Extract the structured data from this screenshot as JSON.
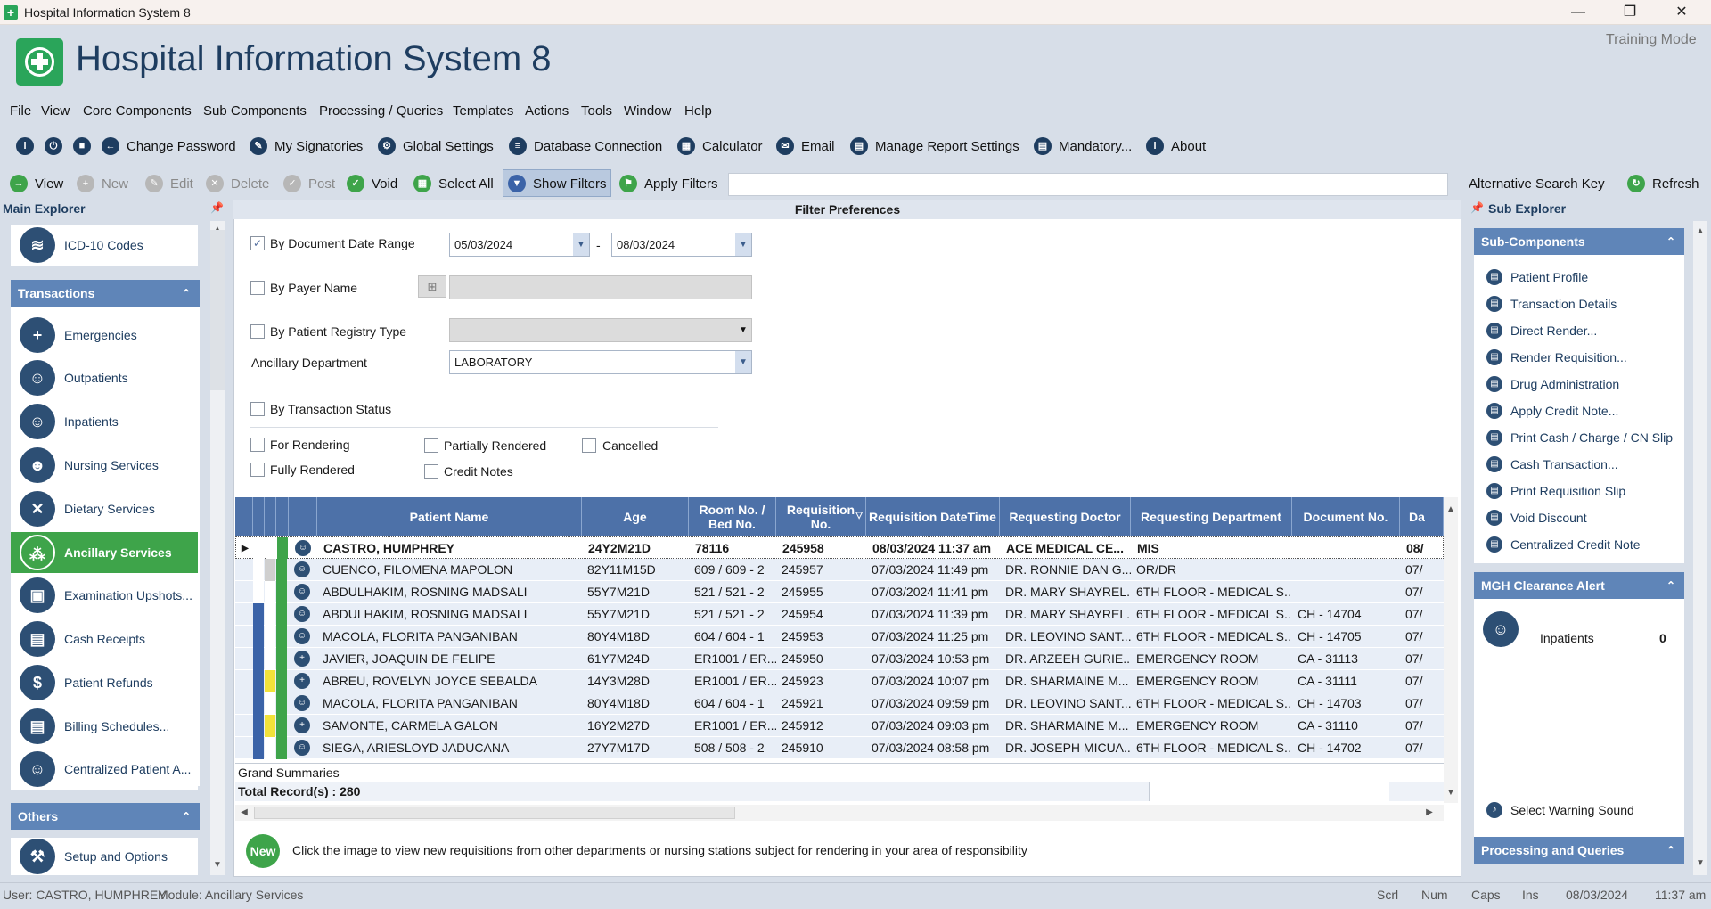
{
  "window": {
    "title": "Hospital Information System 8",
    "minimize": "—",
    "restore": "❐",
    "close": "✕"
  },
  "header": {
    "app_title": "Hospital Information System 8",
    "training_mode": "Training Mode"
  },
  "menu": [
    "File",
    "View",
    "Core Components",
    "Sub Components",
    "Processing / Queries",
    "Templates",
    "Actions",
    "Tools",
    "Window",
    "Help"
  ],
  "toolbar1": {
    "change_password": "Change Password",
    "my_signatories": "My Signatories",
    "global_settings": "Global Settings",
    "database_connection": "Database Connection",
    "calculator": "Calculator",
    "email": "Email",
    "manage_report_settings": "Manage Report Settings",
    "mandatory": "Mandatory...",
    "about": "About"
  },
  "toolbar2": {
    "view": "View",
    "new": "New",
    "edit": "Edit",
    "delete": "Delete",
    "post": "Post",
    "void": "Void",
    "select_all": "Select All",
    "show_filters": "Show Filters",
    "apply_filters": "Apply Filters",
    "alt_search_key": "Alternative Search Key",
    "refresh": "Refresh"
  },
  "main_explorer": {
    "title": "Main Explorer",
    "icd10": "ICD-10 Codes",
    "transactions_header": "Transactions",
    "transactions": [
      "Emergencies",
      "Outpatients",
      "Inpatients",
      "Nursing Services",
      "Dietary Services",
      "Ancillary Services",
      "Examination Upshots...",
      "Cash Receipts",
      "Patient Refunds",
      "Billing Schedules...",
      "Centralized Patient A..."
    ],
    "others_header": "Others",
    "setup": "Setup and Options"
  },
  "filter": {
    "title": "Filter Preferences",
    "by_doc_date": "By Document Date Range",
    "date_from": "05/03/2024",
    "date_sep": "-",
    "date_to": "08/03/2024",
    "by_payer": "By Payer Name",
    "by_registry": "By Patient Registry Type",
    "ancillary_label": "Ancillary Department",
    "ancillary_value": "LABORATORY",
    "by_status": "By Transaction Status",
    "for_rendering": "For Rendering",
    "partially_rendered": "Partially Rendered",
    "cancelled": "Cancelled",
    "fully_rendered": "Fully Rendered",
    "credit_notes": "Credit Notes"
  },
  "grid": {
    "columns": [
      "Patient Name",
      "Age",
      "Room No. / Bed No.",
      "Requisition No.",
      "Requisition DateTime",
      "Requesting Doctor",
      "Requesting Department",
      "Document No.",
      "Da"
    ],
    "rows": [
      {
        "name": "CASTRO, HUMPHREY",
        "age": "24Y2M21D",
        "room": "78116",
        "req": "245958",
        "dt": "08/03/2024 11:37 am",
        "doctor": "ACE MEDICAL CE...",
        "dept": "MIS",
        "doc": "",
        "da": "08/"
      },
      {
        "name": "CUENCO, FILOMENA MAPOLON",
        "age": "82Y11M15D",
        "room": "609 / 609 - 2",
        "req": "245957",
        "dt": "07/03/2024 11:49 pm",
        "doctor": "DR. RONNIE DAN G...",
        "dept": "OR/DR",
        "doc": "",
        "da": "07/"
      },
      {
        "name": "ABDULHAKIM, ROSNING MADSALI",
        "age": "55Y7M21D",
        "room": "521 / 521 - 2",
        "req": "245955",
        "dt": "07/03/2024 11:41 pm",
        "doctor": "DR. MARY SHAYREL...",
        "dept": "6TH FLOOR - MEDICAL S...",
        "doc": "",
        "da": "07/"
      },
      {
        "name": "ABDULHAKIM, ROSNING MADSALI",
        "age": "55Y7M21D",
        "room": "521 / 521 - 2",
        "req": "245954",
        "dt": "07/03/2024 11:39 pm",
        "doctor": "DR. MARY SHAYREL...",
        "dept": "6TH FLOOR - MEDICAL S...",
        "doc": "CH - 14704",
        "da": "07/"
      },
      {
        "name": "MACOLA, FLORITA PANGANIBAN",
        "age": "80Y4M18D",
        "room": "604 / 604 - 1",
        "req": "245953",
        "dt": "07/03/2024 11:25 pm",
        "doctor": "DR. LEOVINO SANT...",
        "dept": "6TH FLOOR - MEDICAL S...",
        "doc": "CH - 14705",
        "da": "07/"
      },
      {
        "name": "JAVIER, JOAQUIN DE FELIPE",
        "age": "61Y7M24D",
        "room": "ER1001 / ER...",
        "req": "245950",
        "dt": "07/03/2024 10:53 pm",
        "doctor": "DR. ARZEEH GURIE...",
        "dept": "EMERGENCY ROOM",
        "doc": "CA - 31113",
        "da": "07/"
      },
      {
        "name": "ABREU, ROVELYN JOYCE SEBALDA",
        "age": "14Y3M28D",
        "room": "ER1001 / ER...",
        "req": "245923",
        "dt": "07/03/2024 10:07 pm",
        "doctor": "DR. SHARMAINE M...",
        "dept": "EMERGENCY ROOM",
        "doc": "CA - 31111",
        "da": "07/"
      },
      {
        "name": "MACOLA, FLORITA PANGANIBAN",
        "age": "80Y4M18D",
        "room": "604 / 604 - 1",
        "req": "245921",
        "dt": "07/03/2024 09:59 pm",
        "doctor": "DR. LEOVINO SANT...",
        "dept": "6TH FLOOR - MEDICAL S...",
        "doc": "CH - 14703",
        "da": "07/"
      },
      {
        "name": "SAMONTE, CARMELA GALON",
        "age": "16Y2M27D",
        "room": "ER1001 / ER...",
        "req": "245912",
        "dt": "07/03/2024 09:03 pm",
        "doctor": "DR. SHARMAINE M...",
        "dept": "EMERGENCY ROOM",
        "doc": "CA - 31110",
        "da": "07/"
      },
      {
        "name": "SIEGA, ARIESLOYD JADUCANA",
        "age": "27Y7M17D",
        "room": "508 / 508 - 2",
        "req": "245910",
        "dt": "07/03/2024 08:58 pm",
        "doctor": "DR. JOSEPH MICUA...",
        "dept": "6TH FLOOR - MEDICAL S...",
        "doc": "CH - 14702",
        "da": "07/"
      }
    ],
    "grand_summaries": "Grand Summaries",
    "total_records": "Total Record(s) : 280"
  },
  "new_badge": "New",
  "new_message": "Click the image to view new requisitions from other departments or nursing stations subject for rendering in your area of responsibility",
  "sub_explorer": {
    "title": "Sub Explorer",
    "subcomponents_header": "Sub-Components",
    "items": [
      "Patient Profile",
      "Transaction Details",
      "Direct Render...",
      "Render Requisition...",
      "Drug Administration",
      "Apply Credit Note...",
      "Print Cash / Charge / CN Slip",
      "Cash Transaction...",
      "Print Requisition Slip",
      "Void Discount",
      "Centralized Credit Note"
    ],
    "clearance_header": "MGH Clearance Alert",
    "clearance_label": "Inpatients",
    "clearance_count": "0",
    "warning_sound": "Select Warning Sound",
    "processing_header": "Processing and Queries"
  },
  "status": {
    "user": "User: CASTRO, HUMPHREY",
    "module": "Module: Ancillary Services",
    "scrl": "Scrl",
    "num": "Num",
    "caps": "Caps",
    "ins": "Ins",
    "date": "08/03/2024",
    "time": "11:37 am"
  },
  "colors": {
    "accent": "#2aa55a",
    "header_blue": "#4d71a8",
    "selected_nav": "#3ea44a"
  }
}
